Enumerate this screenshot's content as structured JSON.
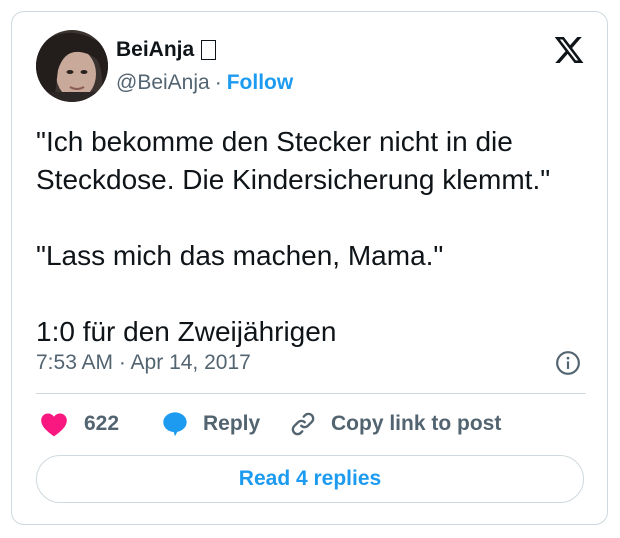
{
  "author": {
    "display_name": "BeiAnja",
    "handle": "@BeiAnja",
    "separator": "·",
    "follow_label": "Follow"
  },
  "tweet": {
    "line1": "\"Ich bekomme den Stecker nicht in die",
    "line2": "Steckdose. Die Kindersicherung klemmt.\"",
    "line3": "\"Lass mich das machen, Mama.\"",
    "line4": "1:0 für den Zweijährigen"
  },
  "timestamp": "7:53 AM · Apr 14, 2017",
  "actions": {
    "like_count": "622",
    "reply_label": "Reply",
    "copy_label": "Copy link to post"
  },
  "read_replies_label": "Read 4 replies",
  "icons": {
    "logo": "x-logo-icon",
    "info": "info-icon",
    "like": "heart-icon",
    "reply": "speech-bubble-icon",
    "copy": "link-icon",
    "badge": "unknown-glyph-icon"
  },
  "colors": {
    "accent": "#1d9bf0",
    "like": "#f91880",
    "text": "#0f1419",
    "muted": "#536471",
    "border": "#cfd9de"
  }
}
